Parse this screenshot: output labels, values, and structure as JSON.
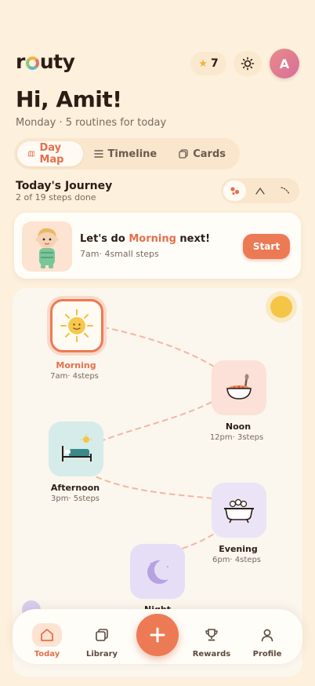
{
  "app": {
    "logo_text_start": "r",
    "logo_text_end": "uty"
  },
  "header": {
    "stars_count": "7",
    "avatar_initial": "A"
  },
  "greeting": {
    "title": "Hi, Amit!",
    "subtitle": "Monday · 5 routines for today"
  },
  "tabs": [
    {
      "label": "Day Map",
      "icon": "map-icon",
      "active": true
    },
    {
      "label": "Timeline",
      "icon": "list-icon",
      "active": false
    },
    {
      "label": "Cards",
      "icon": "cards-icon",
      "active": false
    }
  ],
  "journey": {
    "title": "Today's Journey",
    "progress": "2 of 19 steps done",
    "view_options": [
      "dots-view-icon",
      "path-view-icon",
      "scatter-view-icon"
    ]
  },
  "next": {
    "prefix": "Let's do ",
    "routine": "Morning",
    "suffix": " next!",
    "meta": "7am· 4small steps",
    "button": "Start"
  },
  "routines": [
    {
      "name": "Morning",
      "meta": "7am· 4steps",
      "icon": "sun-icon",
      "color": "#fde3d2",
      "current": true
    },
    {
      "name": "Noon",
      "meta": "12pm· 3steps",
      "icon": "bowl-icon",
      "color": "#fbe1d8"
    },
    {
      "name": "Afternoon",
      "meta": "3pm· 5steps",
      "icon": "bed-icon",
      "color": "#d6ecea"
    },
    {
      "name": "Evening",
      "meta": "6pm· 4steps",
      "icon": "bathtub-icon",
      "color": "#ebe4f6"
    },
    {
      "name": "Night",
      "meta": "",
      "icon": "moon-icon",
      "color": "#e6def6"
    }
  ],
  "nav": [
    {
      "label": "Today",
      "icon": "home-icon",
      "active": true
    },
    {
      "label": "Library",
      "icon": "library-icon"
    },
    {
      "label": "Rewards",
      "icon": "trophy-icon"
    },
    {
      "label": "Profile",
      "icon": "profile-icon"
    }
  ],
  "colors": {
    "accent": "#ec7a54",
    "background": "#fdf0dc",
    "path": "#f2b8a2"
  }
}
